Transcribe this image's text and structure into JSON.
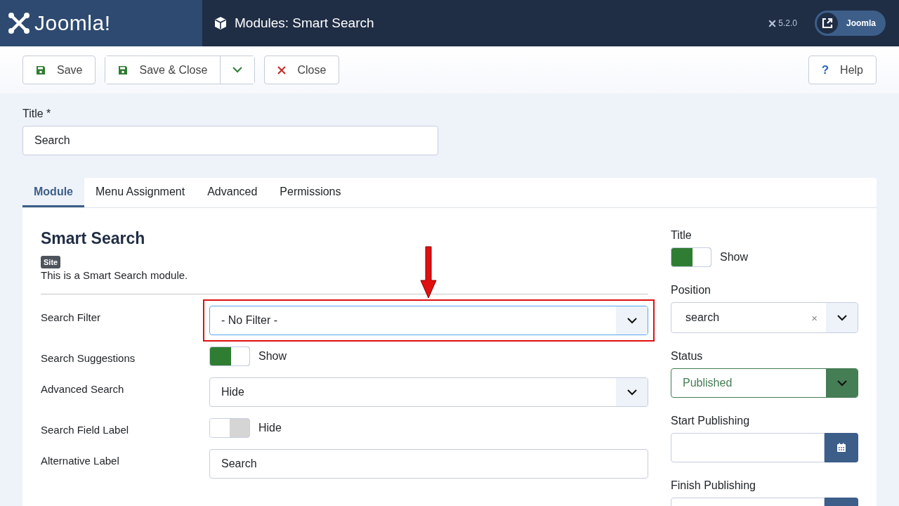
{
  "header": {
    "logo_text": "Joomla!",
    "title": "Modules: Smart Search",
    "version": "5.2.0",
    "site_button": "Joomla"
  },
  "toolbar": {
    "buttons": [
      {
        "label": "Save",
        "kind": "save"
      },
      {
        "label": "Save & Close",
        "kind": "save-split"
      },
      {
        "label": "Close",
        "kind": "close"
      }
    ],
    "help": "Help",
    "help_icon": "?"
  },
  "title_field": {
    "label": "Title *",
    "value": "Search"
  },
  "tabs": [
    {
      "label": "Module",
      "selected": true
    },
    {
      "label": "Menu Assignment",
      "selected": false
    },
    {
      "label": "Advanced",
      "selected": false
    },
    {
      "label": "Permissions",
      "selected": false
    }
  ],
  "module": {
    "heading": "Smart Search",
    "badge": "Site",
    "description": "This is a Smart Search module."
  },
  "fields": [
    {
      "label": "Search Filter",
      "kind": "select",
      "value": "- No Filter -",
      "highlighted": true,
      "focused": true
    },
    {
      "label": "Search Suggestions",
      "kind": "toggle",
      "on": true,
      "text": "Show"
    },
    {
      "label": "Advanced Search",
      "kind": "select",
      "value": "Hide",
      "highlighted": false,
      "focused": false
    },
    {
      "label": "Search Field Label",
      "kind": "toggle",
      "on": false,
      "text": "Hide"
    },
    {
      "label": "Alternative Label",
      "kind": "text",
      "value": "Search"
    }
  ],
  "side": [
    {
      "label": "Title",
      "kind": "toggle",
      "on": true,
      "text": "Show"
    },
    {
      "label": "Position",
      "kind": "position",
      "value": "search",
      "clear": "×"
    },
    {
      "label": "Status",
      "kind": "status",
      "value": "Published"
    },
    {
      "label": "Start Publishing",
      "kind": "date"
    },
    {
      "label": "Finish Publishing",
      "kind": "date"
    }
  ]
}
